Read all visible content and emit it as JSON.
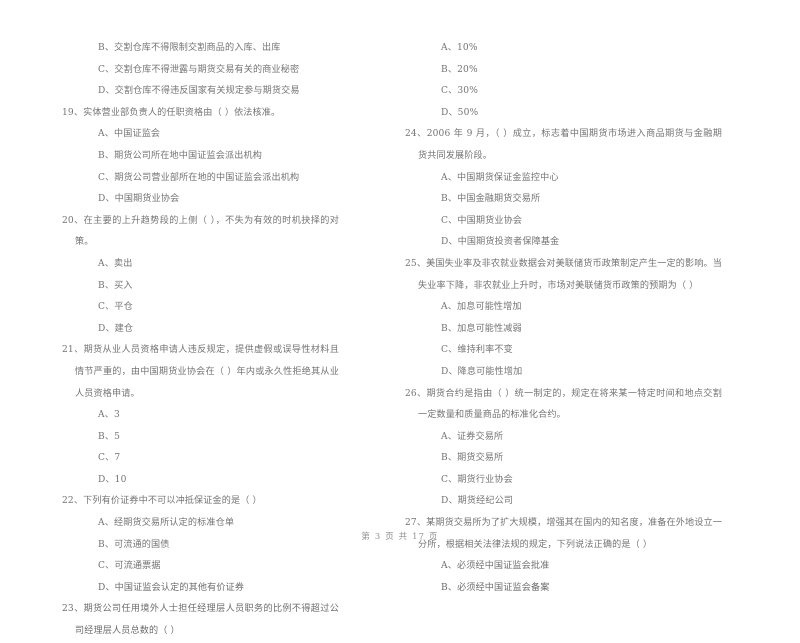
{
  "document": {
    "type": "exam-paper",
    "language": "zh-CN",
    "footer": "第 3 页  共 17 页"
  },
  "left_column": {
    "continued_options": [
      "B、交割仓库不得限制交割商品的入库、出库",
      "C、交割仓库不得泄露与期货交易有关的商业秘密",
      "D、交割仓库不得违反国家有关规定参与期货交易"
    ],
    "questions": [
      {
        "number": "19、",
        "stem": "实体营业部负责人的任职资格由（      ）依法核准。",
        "options": [
          "A、中国证监会",
          "B、期货公司所在地中国证监会派出机构",
          "C、期货公司营业部所在地的中国证监会派出机构",
          "D、中国期货业协会"
        ]
      },
      {
        "number": "20、",
        "stem": "在主要的上升趋势段的上侧（      ），不失为有效的时机抉择的对策。",
        "options": [
          "A、卖出",
          "B、买入",
          "C、平仓",
          "D、建仓"
        ]
      },
      {
        "number": "21、",
        "stem": "期货从业人员资格申请人违反规定，提供虚假或误导性材料且情节严重的，由中国期货业协会在（      ）年内或永久性拒绝其从业人员资格申请。",
        "options": [
          "A、3",
          "B、5",
          "C、7",
          "D、10"
        ]
      },
      {
        "number": "22、",
        "stem": "下列有价证券中不可以冲抵保证金的是（      ）",
        "options": [
          "A、经期货交易所认定的标准仓单",
          "B、可流通的国债",
          "C、可流通票据",
          "D、中国证监会认定的其他有价证券"
        ]
      },
      {
        "number": "23、",
        "stem": "期货公司任用境外人士担任经理层人员职务的比例不得超过公司经理层人员总数的（      ）",
        "options": []
      }
    ]
  },
  "right_column": {
    "continued_options": [
      "A、10%",
      "B、20%",
      "C、30%",
      "D、50%"
    ],
    "questions": [
      {
        "number": "24、",
        "stem": "2006 年 9 月，（      ）成立，标志着中国期货市场进入商品期货与金融期货共同发展阶段。",
        "options": [
          "A、中国期货保证金监控中心",
          "B、中国金融期货交易所",
          "C、中国期货业协会",
          "D、中国期货投资者保障基金"
        ]
      },
      {
        "number": "25、",
        "stem": "美国失业率及非农就业数据会对美联储货币政策制定产生一定的影响。当失业率下降，非农就业上升时，市场对美联储货币政策的预期为（      ）",
        "options": [
          "A、加息可能性增加",
          "B、加息可能性减弱",
          "C、维持利率不变",
          "D、降息可能性增加"
        ]
      },
      {
        "number": "26、",
        "stem": "期货合约是指由（      ）统一制定的，规定在将来某一特定时间和地点交割一定数量和质量商品的标准化合约。",
        "options": [
          "A、证券交易所",
          "B、期货交易所",
          "C、期货行业协会",
          "D、期货经纪公司"
        ]
      },
      {
        "number": "27、",
        "stem": "某期货交易所为了扩大规模，增强其在国内的知名度，准备在外地设立一分所，根据相关法律法规的规定，下列说法正确的是（      ）",
        "options": [
          "A、必须经中国证监会批准",
          "B、必须经中国证监会备案"
        ]
      }
    ]
  }
}
